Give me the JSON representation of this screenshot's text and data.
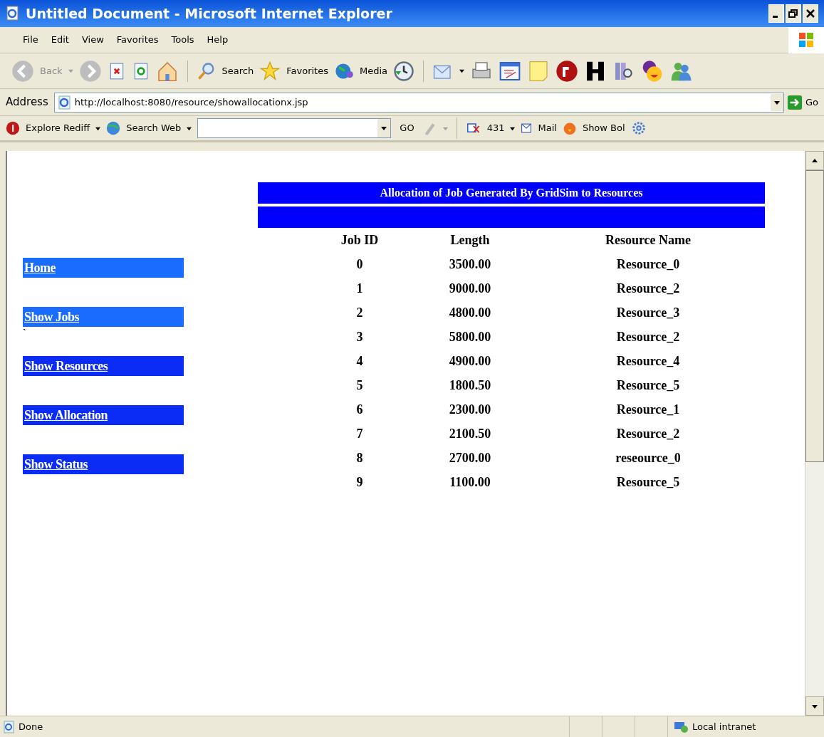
{
  "window": {
    "title": "Untitled Document - Microsoft Internet Explorer"
  },
  "menu": [
    "File",
    "Edit",
    "View",
    "Favorites",
    "Tools",
    "Help"
  ],
  "toolbar": {
    "back_label": "Back",
    "search_label": "Search",
    "favorites_label": "Favorites",
    "media_label": "Media"
  },
  "address_bar": {
    "label": "Address",
    "value": "http://localhost:8080/resource/showallocationx.jsp",
    "go_label": "Go"
  },
  "links_bar": {
    "explore_label": "Explore Rediff",
    "search_label": "Search Web",
    "go_label": "GO",
    "count": "431",
    "mail_label": "Mail",
    "show_label": "Show Bol"
  },
  "page": {
    "nav": [
      {
        "label": "Home",
        "color": "#1a6cff"
      },
      {
        "label": "Show Jobs",
        "color": "#1a6cff"
      },
      {
        "label": "Show Resources",
        "color": "#0a2cf5"
      },
      {
        "label": "Show Allocation",
        "color": "#0a2cf5"
      },
      {
        "label": "Show Status",
        "color": "#0a2cf5"
      }
    ],
    "stray_mark": "`",
    "table": {
      "title": "Allocation of Job Generated By GridSim to Resources",
      "columns": [
        "Job ID",
        "Length",
        "Resource Name"
      ],
      "rows": [
        [
          "0",
          "3500.00",
          "Resource_0"
        ],
        [
          "1",
          "9000.00",
          "Resource_2"
        ],
        [
          "2",
          "4800.00",
          "Resource_3"
        ],
        [
          "3",
          "5800.00",
          "Resource_2"
        ],
        [
          "4",
          "4900.00",
          "Resource_4"
        ],
        [
          "5",
          "1800.50",
          "Resource_5"
        ],
        [
          "6",
          "2300.00",
          "Resource_1"
        ],
        [
          "7",
          "2100.50",
          "Resource_2"
        ],
        [
          "8",
          "2700.00",
          "reseource_0"
        ],
        [
          "9",
          "1100.00",
          "Resource_5"
        ]
      ]
    }
  },
  "status_bar": {
    "text": "Done",
    "zone": "Local intranet"
  }
}
